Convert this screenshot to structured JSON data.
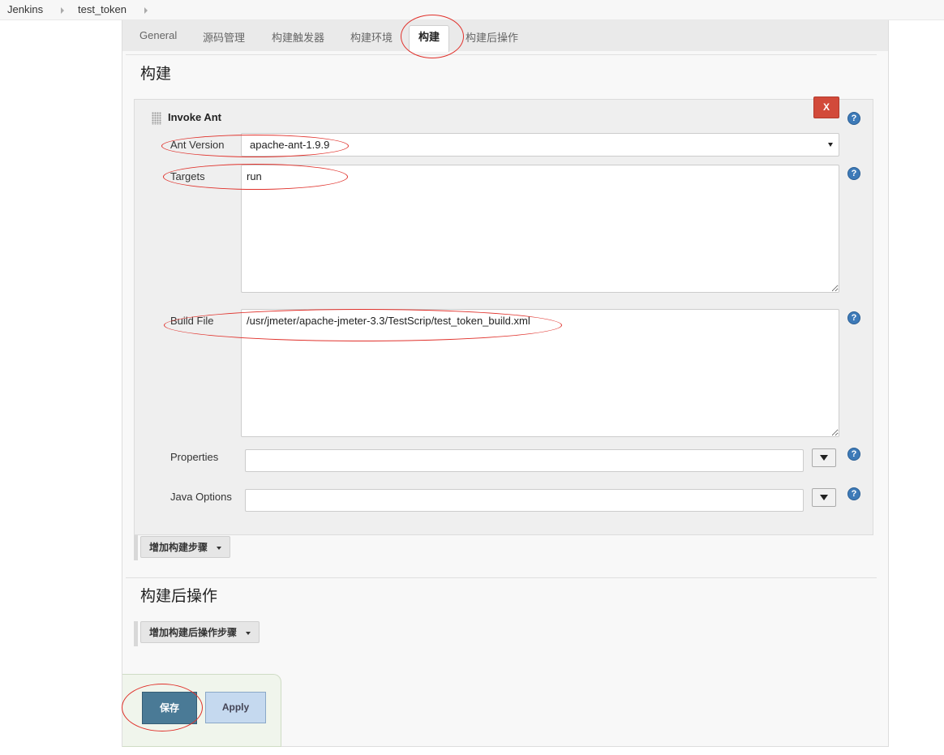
{
  "breadcrumb": {
    "items": [
      "Jenkins",
      "test_token"
    ]
  },
  "tabs": [
    "General",
    "源码管理",
    "构建触发器",
    "构建环境",
    "构建",
    "构建后操作"
  ],
  "active_tab": "构建",
  "build_section": {
    "title": "构建",
    "step": {
      "title": "Invoke Ant",
      "delete_label": "X",
      "ant_version": {
        "label": "Ant Version",
        "value": "apache-ant-1.9.9"
      },
      "targets": {
        "label": "Targets",
        "value": "run"
      },
      "build_file": {
        "label": "Build File",
        "value": "/usr/jmeter/apache-jmeter-3.3/TestScrip/test_token_build.xml"
      },
      "properties": {
        "label": "Properties",
        "value": ""
      },
      "java_options": {
        "label": "Java Options",
        "value": ""
      },
      "help_glyph": "?"
    },
    "add_step_label": "增加构建步骤"
  },
  "post_build_section": {
    "title": "构建后操作",
    "add_step_label": "增加构建后操作步骤"
  },
  "actions": {
    "save_label": "保存",
    "apply_label": "Apply"
  },
  "colors": {
    "annotation": "#e0312b",
    "delete_button": "#d24a3a",
    "save_button": "#4a7a96",
    "apply_button": "#c5d9ef",
    "help_icon": "#3d7ab8"
  }
}
